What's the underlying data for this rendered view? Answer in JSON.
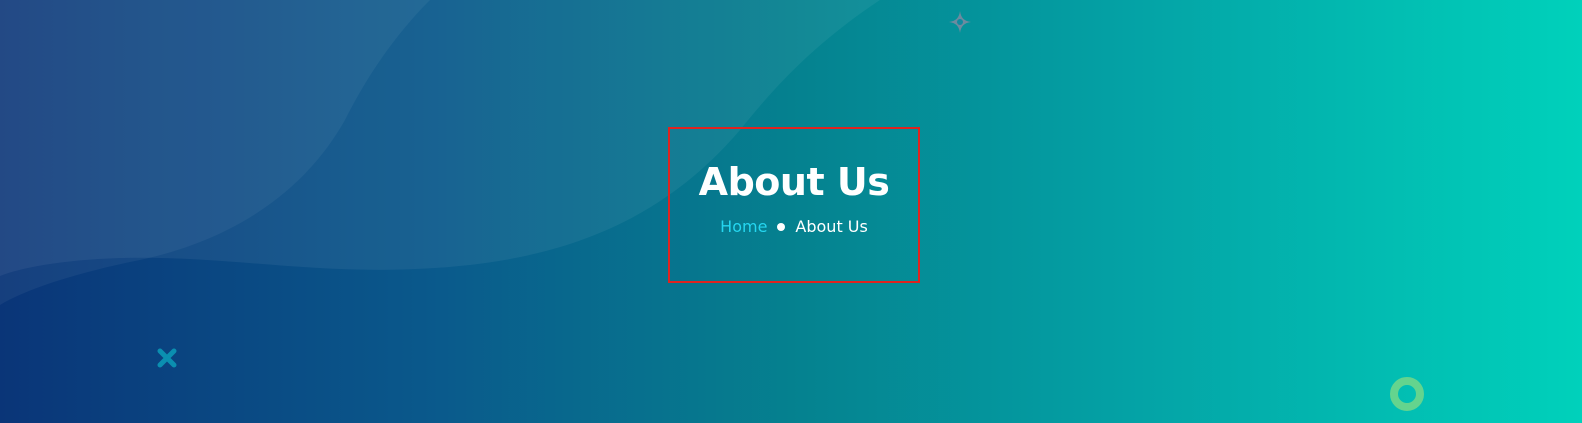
{
  "page": {
    "title": "About Us"
  },
  "breadcrumb": {
    "home_label": "Home",
    "current_label": "About Us"
  },
  "colors": {
    "gradient_start": "#0a3578",
    "gradient_end": "#00d1bb",
    "breadcrumb_link": "#25d6f0",
    "highlight_border": "#e0231f",
    "title_text": "#ffffff"
  },
  "decorations": {
    "icons": [
      "sparkle-star-icon",
      "cross-icon",
      "ring-icon"
    ]
  }
}
